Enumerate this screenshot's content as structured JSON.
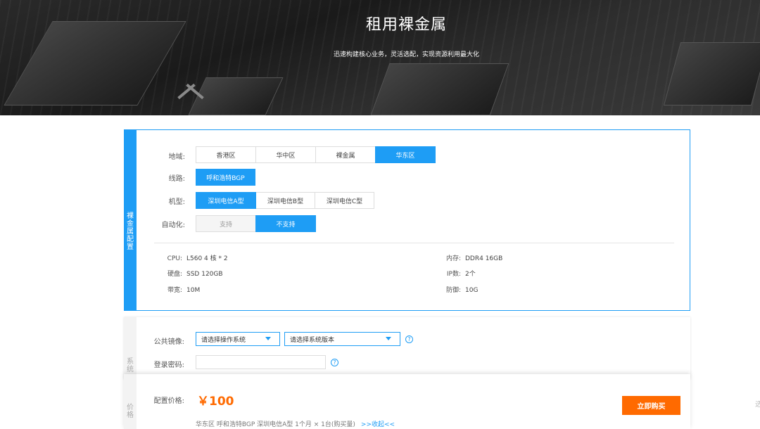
{
  "hero": {
    "title": "租用裸金属",
    "subtitle": "迅速构建核心业务，灵活选配，实现资源利用最大化"
  },
  "config": {
    "section_tag": "裸金属配置",
    "region": {
      "label": "地域:",
      "options": [
        "香港区",
        "华中区",
        "裸金属",
        "华东区"
      ],
      "selected": "华东区"
    },
    "line": {
      "label": "线路:",
      "options": [
        "呼和浩特BGP"
      ],
      "selected": "呼和浩特BGP"
    },
    "model": {
      "label": "机型:",
      "options": [
        "深圳电信A型",
        "深圳电信B型",
        "深圳电信C型"
      ],
      "selected": "深圳电信A型"
    },
    "automation": {
      "label": "自动化:",
      "options": [
        "支持",
        "不支持"
      ],
      "selected": "不支持"
    },
    "specs": {
      "cpu": {
        "k": "CPU:",
        "v": "L560   4 核 * 2"
      },
      "memory": {
        "k": "内存:",
        "v": "DDR4 16GB"
      },
      "disk": {
        "k": "硬盘:",
        "v": "SSD 120GB"
      },
      "ip": {
        "k": "IP数:",
        "v": "2个"
      },
      "bandwidth": {
        "k": "带宽:",
        "v": "10M"
      },
      "defense": {
        "k": "防御:",
        "v": "10G"
      }
    }
  },
  "system": {
    "section_tag": "系统",
    "image": {
      "label": "公共镜像:",
      "os_placeholder": "请选择操作系统",
      "version_placeholder": "请选择系统版本"
    },
    "password": {
      "label": "登录密码:",
      "value": ""
    },
    "help_glyph": "?"
  },
  "price": {
    "section_tag": "价格",
    "label": "配置价格:",
    "value": "￥100",
    "summary": "华东区   呼和浩特BGP   深圳电信A型   1个月 × 1台(购买量)",
    "collapse_link": ">>收起<<",
    "buy_button": "立即购买"
  },
  "edge_text": "选"
}
